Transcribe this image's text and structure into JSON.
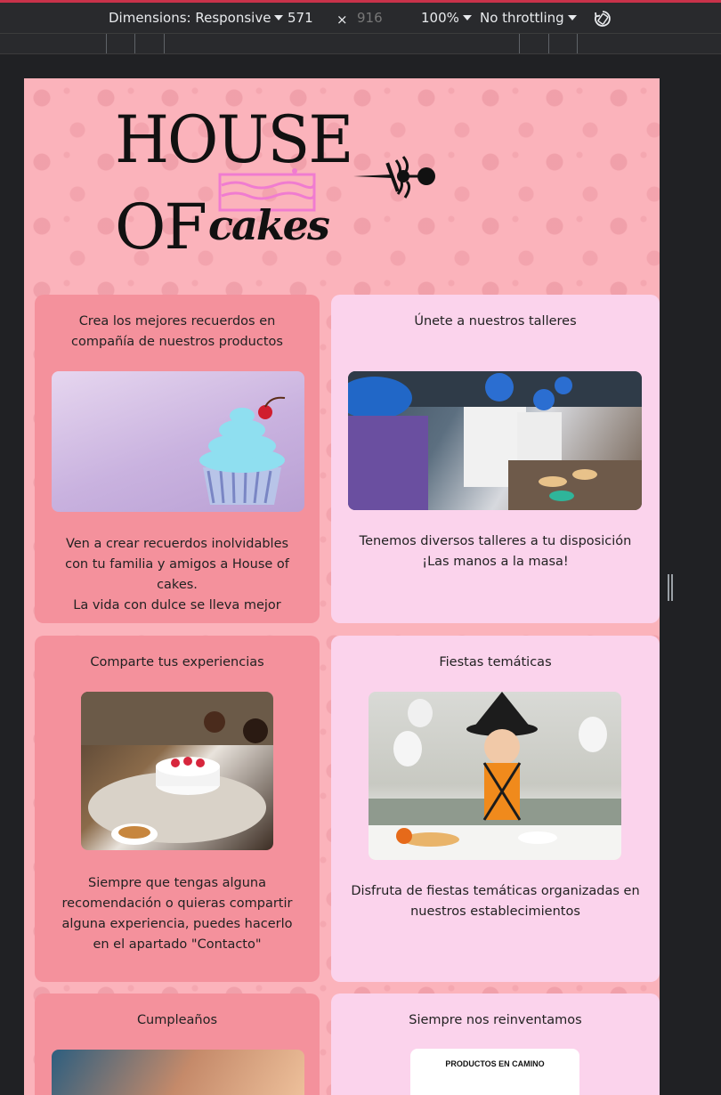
{
  "devtools": {
    "dimensions_label": "Dimensions: Responsive",
    "width": "571",
    "times": "×",
    "height": "916",
    "zoom": "100%",
    "throttling": "No throttling",
    "icons": [
      "caret-down-icon",
      "rotate-icon"
    ]
  },
  "header": {
    "logo_line1": "HOUSE",
    "logo_line2": "OF",
    "logo_cakes": "cakes"
  },
  "cards": [
    {
      "title": "Crea los mejores recuerdos en compañía de nuestros productos",
      "text_lines": [
        "Ven a crear recuerdos inolvidables con tu familia y amigos a House of cakes.",
        "La vida con dulce se lleva mejor"
      ]
    },
    {
      "title": "Únete a nuestros talleres",
      "text_lines": [
        "Tenemos diversos talleres a tu disposición",
        "¡Las manos a la masa!"
      ]
    },
    {
      "title": "Comparte tus experiencias",
      "text_lines": [
        "Siempre que tengas alguna recomendación o quieras compartir alguna experiencia, puedes hacerlo en el apartado \"Contacto\""
      ]
    },
    {
      "title": "Fiestas temáticas",
      "text_lines": [
        "Disfruta de fiestas temáticas organizadas en nuestros establecimientos"
      ]
    },
    {
      "title": "Cumpleaños",
      "text_lines": []
    },
    {
      "title": "Siempre nos reinventamos",
      "image_caption": "PRODUCTOS EN CAMINO",
      "text_lines": []
    }
  ],
  "colors": {
    "page_bg": "#fbb3bb",
    "card_dark": "#f4919c",
    "card_light": "#fbd3ec",
    "devtools_bg": "#292a2d"
  }
}
